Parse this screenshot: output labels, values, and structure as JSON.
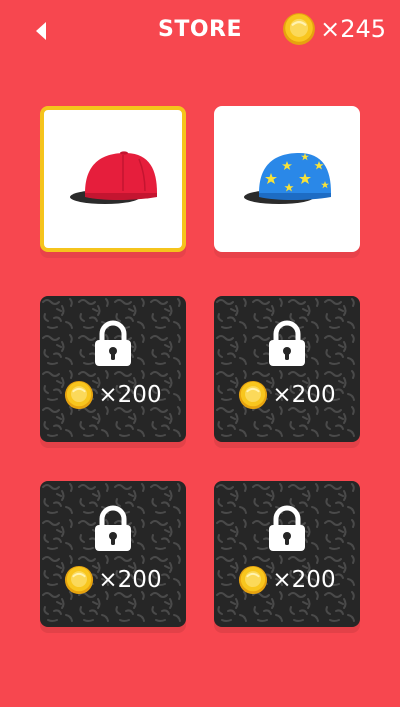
{
  "header": {
    "title": "STORE",
    "coin_balance": "×245"
  },
  "hats": [
    {
      "name": "Red Cap",
      "status": "owned",
      "selected": true
    },
    {
      "name": "Star Cap",
      "status": "owned",
      "selected": false
    }
  ],
  "locked_items": [
    {
      "price": "×200"
    },
    {
      "price": "×200"
    },
    {
      "price": "×200"
    },
    {
      "price": "×200"
    }
  ],
  "colors": {
    "background": "#f7474f",
    "selection_border": "#f5c41c",
    "locked_card": "#262626",
    "coin": "#f8c61e"
  }
}
